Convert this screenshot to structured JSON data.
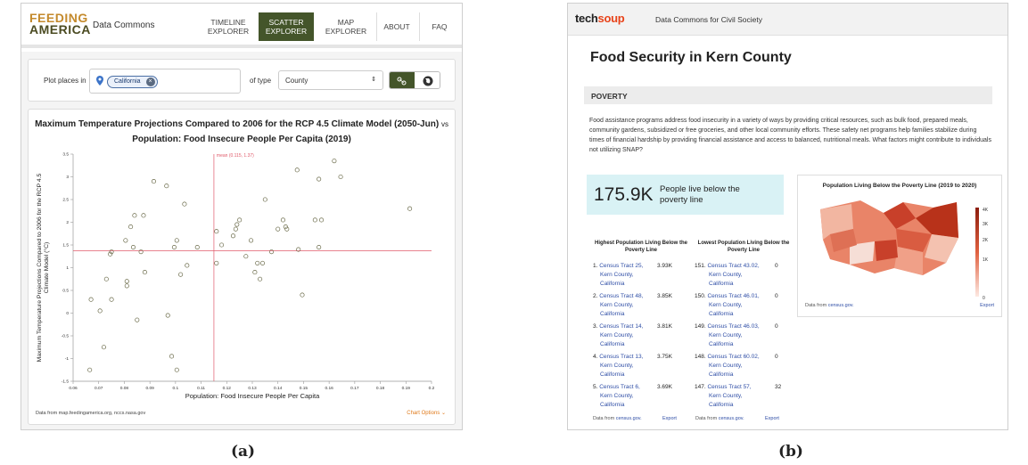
{
  "captions": {
    "a": "(a)",
    "b": "(b)"
  },
  "feeding_america": {
    "logo_top": "FEEDING",
    "logo_bottom": "AMERICA",
    "app_title": "Data Commons",
    "nav": [
      {
        "line1": "TIMELINE",
        "line2": "EXPLORER",
        "active": false
      },
      {
        "line1": "SCATTER",
        "line2": "EXPLORER",
        "active": true
      },
      {
        "line1": "MAP",
        "line2": "EXPLORER",
        "active": false
      },
      {
        "line1": "ABOUT",
        "line2": "",
        "active": false
      },
      {
        "line1": "FAQ",
        "line2": "",
        "active": false
      }
    ],
    "plot_places_label": "Plot places in",
    "place_chip": "California",
    "of_type_label": "of type",
    "place_type": "County",
    "chart_title_line1": "Maximum Temperature Projections Compared to 2006 for the RCP 4.5 Climate Model (2050-Jun)",
    "chart_title_vs": "vs",
    "chart_title_line2": "Population: Food Insecure People Per Capita (2019)",
    "source": "Data from map.feedingamerica.org, nccs.nasa.gov",
    "chart_options": "Chart Options ⌄",
    "colors": {
      "accent": "#44552a",
      "brand_gold": "#c48a2c",
      "mean_line": "#e05a6a",
      "options": "#e07b1d"
    }
  },
  "chart_data": {
    "type": "scatter",
    "title": "Maximum Temperature Projections Compared to 2006 for the RCP 4.5 Climate Model (2050-Jun) vs Population: Food Insecure People Per Capita (2019)",
    "xlabel": "Population: Food Insecure People Per Capita",
    "ylabel": "Maximum Temperature Projections Compared to 2006 for the RCP 4.5 Climate Model (°C)",
    "xlim": [
      0.06,
      0.2
    ],
    "ylim": [
      -1.5,
      3.5
    ],
    "x_ticks": [
      "0.06",
      "0.07",
      "0.08",
      "0.09",
      "0.1",
      "0.11",
      "0.12",
      "0.13",
      "0.14",
      "0.15",
      "0.16",
      "0.17",
      "0.18",
      "0.19",
      "0.2"
    ],
    "y_ticks": [
      "-1.5",
      "-1",
      "-0.5",
      "0",
      "0.5",
      "1",
      "1.5",
      "2",
      "2.5",
      "3",
      "3.5"
    ],
    "mean_label": "mean (0.115, 1.37)",
    "mean": [
      0.115,
      1.37
    ],
    "grid": false,
    "points": [
      [
        0.0665,
        -1.25
      ],
      [
        0.067,
        0.3
      ],
      [
        0.0705,
        0.05
      ],
      [
        0.072,
        -0.75
      ],
      [
        0.073,
        0.75
      ],
      [
        0.075,
        0.3
      ],
      [
        0.0745,
        1.3
      ],
      [
        0.075,
        1.35
      ],
      [
        0.0805,
        1.6
      ],
      [
        0.081,
        0.6
      ],
      [
        0.081,
        0.7
      ],
      [
        0.0825,
        1.9
      ],
      [
        0.0835,
        1.45
      ],
      [
        0.084,
        2.15
      ],
      [
        0.085,
        -0.15
      ],
      [
        0.0865,
        1.35
      ],
      [
        0.0875,
        2.15
      ],
      [
        0.088,
        0.9
      ],
      [
        0.0915,
        2.9
      ],
      [
        0.0965,
        2.8
      ],
      [
        0.097,
        -0.05
      ],
      [
        0.0985,
        -0.95
      ],
      [
        0.0995,
        1.45
      ],
      [
        0.1005,
        1.6
      ],
      [
        0.1005,
        -1.25
      ],
      [
        0.102,
        0.85
      ],
      [
        0.1035,
        2.4
      ],
      [
        0.1045,
        1.05
      ],
      [
        0.1085,
        1.45
      ],
      [
        0.116,
        1.8
      ],
      [
        0.116,
        1.1
      ],
      [
        0.118,
        1.5
      ],
      [
        0.1225,
        1.7
      ],
      [
        0.1235,
        1.85
      ],
      [
        0.124,
        1.95
      ],
      [
        0.125,
        2.05
      ],
      [
        0.1275,
        1.25
      ],
      [
        0.1295,
        1.6
      ],
      [
        0.131,
        0.9
      ],
      [
        0.132,
        1.1
      ],
      [
        0.133,
        0.75
      ],
      [
        0.134,
        1.1
      ],
      [
        0.135,
        2.5
      ],
      [
        0.1375,
        1.35
      ],
      [
        0.14,
        1.85
      ],
      [
        0.142,
        2.05
      ],
      [
        0.143,
        1.9
      ],
      [
        0.1435,
        1.85
      ],
      [
        0.1475,
        3.15
      ],
      [
        0.148,
        1.4
      ],
      [
        0.1495,
        0.4
      ],
      [
        0.1545,
        2.05
      ],
      [
        0.156,
        2.95
      ],
      [
        0.156,
        1.45
      ],
      [
        0.157,
        2.05
      ],
      [
        0.162,
        3.35
      ],
      [
        0.1645,
        3.0
      ],
      [
        0.1915,
        2.3
      ]
    ]
  },
  "techsoup": {
    "logo_tech": "tech",
    "logo_soup": "soup",
    "app_title": "Data Commons for Civil Society",
    "page_title": "Food Security in Kern County",
    "section": "POVERTY",
    "paragraph": "Food assistance programs address food insecurity in a variety of ways by providing critical resources, such as bulk food, prepared meals, community gardens, subsidized or free groceries, and other local community efforts. These safety net programs help families stabilize during times of financial hardship by providing financial assistance and access to balanced, nutritional meals. What factors might contribute to individuals not utilizing SNAP?",
    "stat_value": "175.9K",
    "stat_text": "People live below the poverty line",
    "highest_title": "Highest Population Living Below the Poverty Line",
    "lowest_title": "Lowest Population Living Below the Poverty Line",
    "highest": [
      {
        "rank": "1.",
        "name": "Census Tract 25,",
        "line2": "Kern County,",
        "line3": "California",
        "value": "3.93K"
      },
      {
        "rank": "2.",
        "name": "Census Tract 48,",
        "line2": "Kern County,",
        "line3": "California",
        "value": "3.85K"
      },
      {
        "rank": "3.",
        "name": "Census Tract 14,",
        "line2": "Kern County,",
        "line3": "California",
        "value": "3.81K"
      },
      {
        "rank": "4.",
        "name": "Census Tract 13,",
        "line2": "Kern County,",
        "line3": "California",
        "value": "3.75K"
      },
      {
        "rank": "5.",
        "name": "Census Tract 6,",
        "line2": "Kern County,",
        "line3": "California",
        "value": "3.69K"
      }
    ],
    "lowest": [
      {
        "rank": "151.",
        "name": "Census Tract 43.02,",
        "line2": "Kern County,",
        "line3": "California",
        "value": "0"
      },
      {
        "rank": "150.",
        "name": "Census Tract 46.01,",
        "line2": "Kern County,",
        "line3": "California",
        "value": "0"
      },
      {
        "rank": "149.",
        "name": "Census Tract 46.03,",
        "line2": "Kern County,",
        "line3": "California",
        "value": "0"
      },
      {
        "rank": "148.",
        "name": "Census Tract 60.02,",
        "line2": "Kern County,",
        "line3": "California",
        "value": "0"
      },
      {
        "rank": "147.",
        "name": "Census Tract 57,",
        "line2": "Kern County,",
        "line3": "California",
        "value": "32"
      }
    ],
    "data_from": "Data from",
    "source_link": "census.gov.",
    "export": "Export",
    "map_title": "Population Living Below the Poverty Line (2019 to 2020)",
    "legend_ticks": [
      "4K",
      "3K",
      "2K",
      "1K",
      "0"
    ],
    "colors": {
      "soup": "#e8431a",
      "stat_bg": "#d9f2f5",
      "link": "#2f4ea6",
      "map_high": "#b8321a",
      "map_low": "#f6ded6"
    }
  }
}
